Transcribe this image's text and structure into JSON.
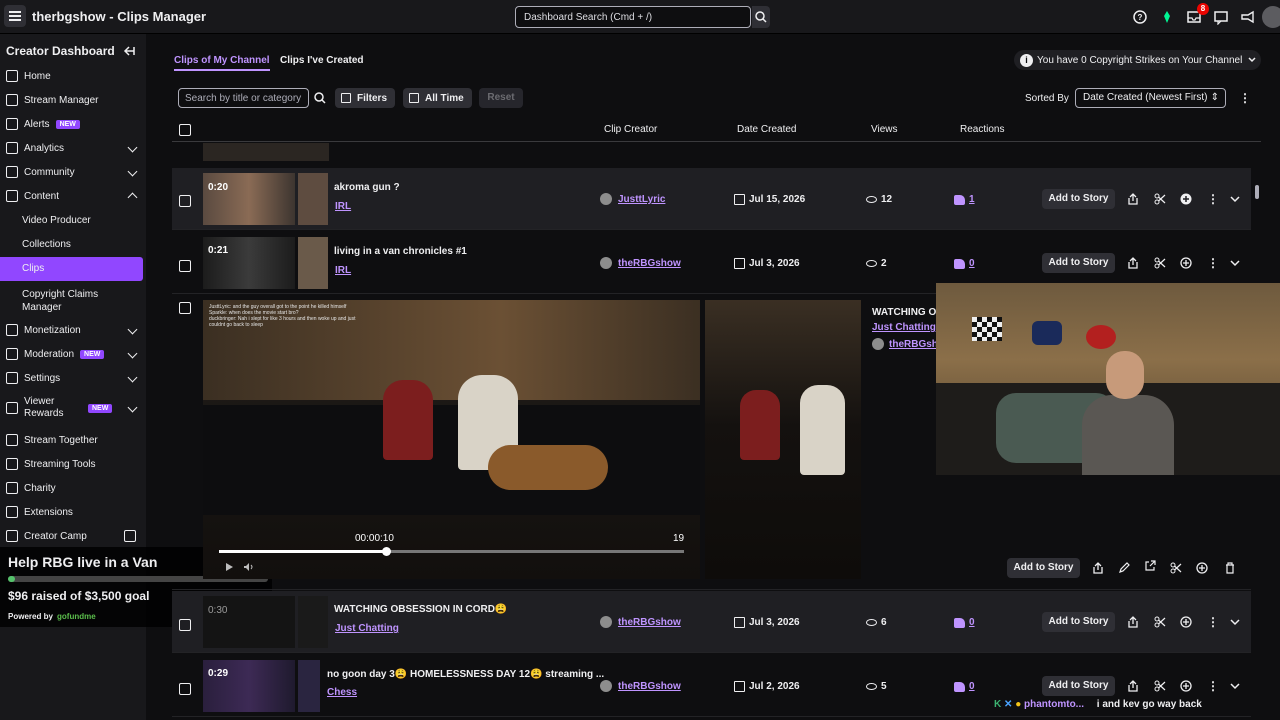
{
  "window": {
    "title": "therbgshow - Clips Manager"
  },
  "search": {
    "placeholder": "Dashboard Search (Cmd + /)"
  },
  "topbar": {
    "notification_count": "8"
  },
  "sidebar": {
    "header": "Creator Dashboard",
    "items": [
      {
        "label": "Home"
      },
      {
        "label": "Stream Manager"
      },
      {
        "label": "Alerts",
        "badge": "NEW"
      },
      {
        "label": "Analytics"
      },
      {
        "label": "Community"
      },
      {
        "label": "Content"
      },
      {
        "label": "Video Producer"
      },
      {
        "label": "Collections"
      },
      {
        "label": "Clips"
      },
      {
        "label": "Copyright Claims Manager"
      },
      {
        "label": "Monetization"
      },
      {
        "label": "Moderation",
        "badge": "NEW"
      },
      {
        "label": "Settings"
      },
      {
        "label": "Viewer Rewards",
        "badge": "NEW"
      },
      {
        "label": "Stream Together"
      },
      {
        "label": "Streaming Tools"
      },
      {
        "label": "Charity"
      },
      {
        "label": "Extensions"
      },
      {
        "label": "Creator Camp"
      }
    ]
  },
  "fundraiser": {
    "title": "Help RBG live in a Van",
    "raised": "$96 raised of $3,500 goal",
    "progress_fraction": 0.027,
    "powered_label": "Powered by",
    "powered_brand": "gofundme"
  },
  "tabs": [
    {
      "label": "Clips of My Channel"
    },
    {
      "label": "Clips I've Created"
    }
  ],
  "copyright": {
    "text": "You have 0 Copyright Strikes on Your Channel"
  },
  "toolbar": {
    "search_placeholder": "Search by title or category",
    "filters_label": "Filters",
    "time_label": "All Time",
    "reset_label": "Reset",
    "sorted_by_label": "Sorted By",
    "sort_value": "Date Created (Newest First)"
  },
  "columns": {
    "creator": "Clip Creator",
    "date": "Date Created",
    "views": "Views",
    "reactions": "Reactions"
  },
  "rows": [
    {
      "duration": "0:20",
      "title": "akroma gun ?",
      "category": "IRL",
      "creator": "JusttLyric",
      "date": "Jul 15, 2026",
      "views": "12",
      "reactions": "1",
      "story": "Add to Story"
    },
    {
      "duration": "0:21",
      "title": "living in a van chronicles #1",
      "category": "IRL",
      "creator": "theRBGshow",
      "date": "Jul 3, 2026",
      "views": "2",
      "reactions": "0",
      "story": "Add to Story"
    },
    {
      "duration": "0:30",
      "title": "WATCHING OBSESSION IN CORD😩",
      "category": "Just Chatting",
      "creator": "theRBGshow",
      "date": "Jul 3, 2026",
      "views": "6",
      "reactions": "0",
      "story": "Add to Story"
    },
    {
      "duration": "0:29",
      "title": "no goon day 3😩 HOMELESSNESS DAY 12😩 streaming ...",
      "category": "Chess",
      "creator": "theRBGshow",
      "date": "Jul 2, 2026",
      "views": "5",
      "reactions": "0",
      "story": "Add to Story"
    }
  ],
  "expanded": {
    "title": "WATCHING OB",
    "category": "Just Chatting",
    "creator": "theRBGsho",
    "position": "00:00:10",
    "end": "19",
    "progress_fraction": 0.36,
    "story": "Add to Story"
  },
  "chat_overlay": {
    "lines": [
      "JusttLyric: and the guy overall got to the point he killed himself",
      "Sparkle: when does the movie start bro?",
      "duckbringer: Nah i slept for like 3 hours and then woke up and just couldnt go back to sleep"
    ]
  },
  "stream_chat": {
    "user": "phantomto...",
    "message": "i and kev go way back"
  },
  "colors": {
    "accent": "#9147ff",
    "accent_text": "#bf94ff",
    "background": "#0e0e10",
    "panel": "#18181b"
  }
}
